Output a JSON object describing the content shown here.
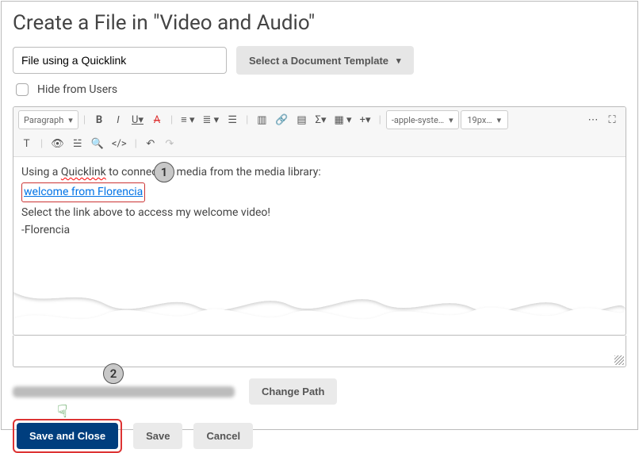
{
  "page": {
    "heading": "Create a File in \"Video and Audio\"",
    "title_value": "File using a Quicklink",
    "template_btn": "Select a Document Template",
    "hide_label": "Hide from Users"
  },
  "toolbar": {
    "paragraph": "Paragraph",
    "font_family": "-apple-syste…",
    "font_size": "19px…",
    "icons": {
      "bold": "B",
      "italic": "I",
      "underline": "U",
      "strike": "A",
      "align": "align",
      "list": "list",
      "outdent": "indent",
      "link": "link",
      "image": "image",
      "sigma": "Σ",
      "grid": "grid",
      "plus": "+",
      "more": "⋯",
      "fullscreen": "⛶",
      "accessibility": "T",
      "eye": "eye",
      "lines": "lines",
      "search": "search",
      "code": "</>",
      "undo": "↶",
      "redo": "↷"
    }
  },
  "content": {
    "line1a": "Using a ",
    "quicklink_word": "Quicklink",
    "line1b": " to connect to media from the media library:",
    "link_text": "welcome from Florencia",
    "line3": "Select the link above to access my welcome video!",
    "line4": "-Florencia"
  },
  "footer": {
    "change_path": "Change Path",
    "save_close": "Save and Close",
    "save": "Save",
    "cancel": "Cancel"
  },
  "callouts": {
    "one": "1",
    "two": "2"
  }
}
